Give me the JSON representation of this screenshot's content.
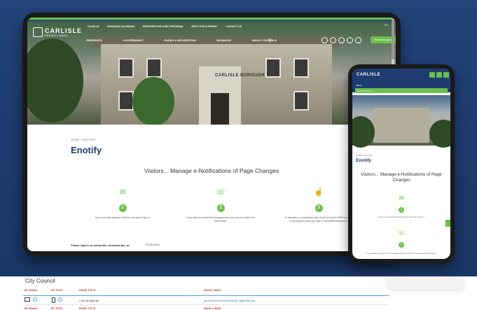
{
  "site": {
    "logo_name": "CARLISLE",
    "logo_sub": "PENNSYLVANIA",
    "util_nav": [
      "COVID-19",
      "BOROUGH CALENDAR",
      "REGISTER FOR A REC PROGRAM",
      "APPLY FOR A PERMIT",
      "CONTACT US"
    ],
    "main_nav": [
      "RESIDENTS",
      "GOVERNMENT",
      "PARKS & RECREATION",
      "BUSINESS",
      "ABOUT CARLISLE"
    ],
    "sign_button": "Report An Issue",
    "lang": "EN",
    "hero_sign": "CARLISLE BOROUGH",
    "breadcrumb": "HOME / ENOTIFY",
    "page_title": "Enotify",
    "section_title": "Visitors... Manage e-Notifications of Page Changes",
    "steps": [
      {
        "num": "1",
        "text": "Type your email address in the box and select Sign In."
      },
      {
        "num": "2",
        "text": "If you want to receive text messages enter your phone number and select Save."
      },
      {
        "num": "3",
        "text": "To subscribe or unsubscribe click Email icon and/or SMS icon next to the pages to which you wish to subscribe/unsubscribe."
      }
    ],
    "signup_text": "Please sign in to subscribe, unsubscribe, or",
    "email_label": "YOUR EMAIL"
  },
  "phone": {
    "logo_name": "CARLISLE",
    "sub_label": "MENU",
    "green_label": "Report An Issue",
    "breadcrumb": "HOME / ENOTIFY",
    "page_title": "Enotify",
    "section_title": "Visitors... Manage e-Notifications of Page Changes",
    "step1_num": "1",
    "step1_text": "Type your email address in the box and select Sign In.",
    "step2_num": "2",
    "step2_text": "If you want to receive text messages enter your phone number and select Save."
  },
  "table": {
    "title": "City Council",
    "headers": [
      "BY EMAIL",
      "BY TEXT",
      "PAGE TITLE",
      "PAGE LINKS"
    ],
    "row": {
      "title": "Council Agenda",
      "link": "government/council/council_agendas.php"
    },
    "headers2": [
      "BY EMAIL",
      "BY TEXT",
      "PAGE TITLE",
      "PAGE LINKS"
    ]
  }
}
